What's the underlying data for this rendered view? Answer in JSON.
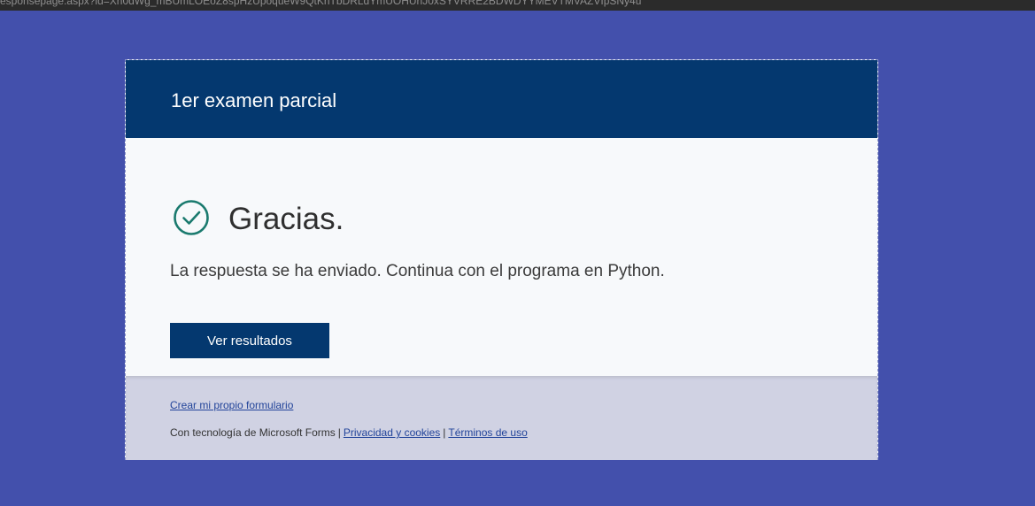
{
  "browser": {
    "url_fragment": "esponsepage.aspx?id=Xn0dWg_mBUmLOEoZ8spHzUpoqueW9QtKhTbDRLdYmUOHUhJ0xSYVRRE2BDWDYYMEVTMVAZVIpSNy4u"
  },
  "form": {
    "title": "1er examen parcial"
  },
  "confirmation": {
    "icon": "check-circle-icon",
    "heading": "Gracias.",
    "message": "La respuesta se ha enviado. Continua con el programa en Python.",
    "button_label": "Ver resultados"
  },
  "footer": {
    "create_link": "Crear mi propio formulario",
    "powered_by": "Con tecnología de Microsoft Forms",
    "privacy_link": "Privacidad y cookies",
    "terms_link": "Términos de uso",
    "separator": "|"
  },
  "colors": {
    "page_background": "#4350ac",
    "header_background": "#04386f",
    "check_icon": "#1a7a6e",
    "footer_background": "#d0d2e3",
    "link": "#22449a"
  }
}
